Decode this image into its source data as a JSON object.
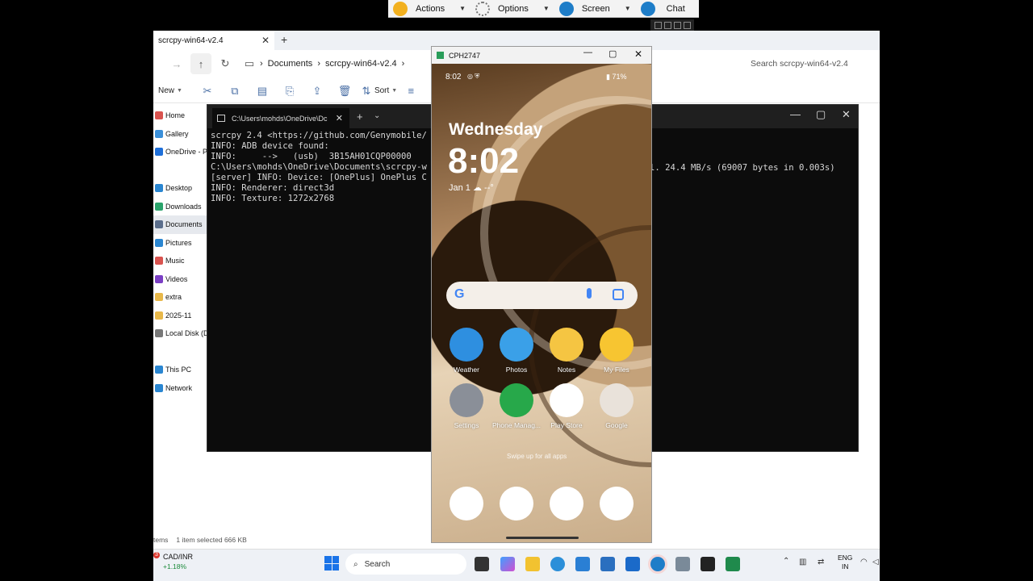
{
  "remote_toolbar": {
    "items": [
      {
        "label": "Actions",
        "icon": "lightning-icon"
      },
      {
        "label": "Options",
        "icon": "gear-icon"
      },
      {
        "label": "Screen",
        "icon": "screen-icon"
      },
      {
        "label": "Chat",
        "icon": "chat-icon"
      }
    ]
  },
  "explorer": {
    "tab_title": "scrcpy-win64-v2.4",
    "breadcrumb": [
      "Documents",
      "scrcpy-win64-v2.4"
    ],
    "search_placeholder": "Search scrcpy-win64-v2.4",
    "cmd": {
      "new_label": "New",
      "sort_label": "Sort"
    },
    "sidebar": [
      {
        "label": "Home",
        "color": "#d9534f"
      },
      {
        "label": "Gallery",
        "color": "#3a8fd9"
      },
      {
        "label": "OneDrive - Pe",
        "color": "#1e6fd9"
      },
      {
        "label": "",
        "color": ""
      },
      {
        "label": "Desktop",
        "color": "#2a86d1"
      },
      {
        "label": "Downloads",
        "color": "#2aa36b"
      },
      {
        "label": "Documents",
        "color": "#5b6e8c"
      },
      {
        "label": "Pictures",
        "color": "#2a86d1"
      },
      {
        "label": "Music",
        "color": "#d9534f"
      },
      {
        "label": "Videos",
        "color": "#7b3fc4"
      },
      {
        "label": "extra",
        "color": "#e8b84a"
      },
      {
        "label": "2025-11",
        "color": "#e8b84a"
      },
      {
        "label": "Local Disk (D:",
        "color": "#777777"
      },
      {
        "label": "",
        "color": ""
      },
      {
        "label": "This PC",
        "color": "#2a86d1"
      },
      {
        "label": "Network",
        "color": "#2a86d1"
      }
    ],
    "status": [
      "tems",
      "1 item selected  666 KB"
    ]
  },
  "terminal": {
    "tab_title": "C:\\Users\\mohds\\OneDrive\\Dc",
    "lines": [
      "scrcpy 2.4 <https://github.com/Genymobile/",
      "INFO: ADB device found:",
      "INFO:     -->   (usb)  3B15AH01CQP00000",
      "C:\\Users\\mohds\\OneDrive\\Documents\\scrcpy-w",
      "[server] INFO: Device: [OnePlus] OnePlus C",
      "INFO: Renderer: direct3d",
      "INFO: Texture: 1272x2768"
    ],
    "right_fragment": "l. 24.4 MB/s (69007 bytes in 0.003s)"
  },
  "phone": {
    "window_title": "CPH2747",
    "status_time": "8:02",
    "battery": "71%",
    "day": "Wednesday",
    "clock": "8:02",
    "date_weather": "Jan 1",
    "weather_temp": "--°",
    "apps_row1": [
      {
        "label": "Weather",
        "color": "#2e8fe0"
      },
      {
        "label": "Photos",
        "color": "#3aa0e8"
      },
      {
        "label": "Notes",
        "color": "#f5c542"
      },
      {
        "label": "My Files",
        "color": "#f7c531"
      }
    ],
    "apps_row2": [
      {
        "label": "Settings",
        "color": "#8a8f98"
      },
      {
        "label": "Phone Manag...",
        "color": "#27a84a"
      },
      {
        "label": "Play Store",
        "color": "#ffffff"
      },
      {
        "label": "Google",
        "color": "#e9e2da"
      }
    ],
    "swipe_hint": "Swipe up for all apps",
    "dock": [
      {
        "name": "phone-dock-icon",
        "color": "#ffffff"
      },
      {
        "name": "messages-dock-icon",
        "color": "#ffffff"
      },
      {
        "name": "chrome-dock-icon",
        "color": "#ffffff"
      },
      {
        "name": "camera-dock-icon",
        "color": "#ffffff"
      }
    ]
  },
  "taskbar": {
    "ticker": "CAD/INR",
    "ticker_change": "+1.18%",
    "ticker_badge": "3",
    "search_label": "Search",
    "lang": "ENG",
    "region": "IN"
  }
}
